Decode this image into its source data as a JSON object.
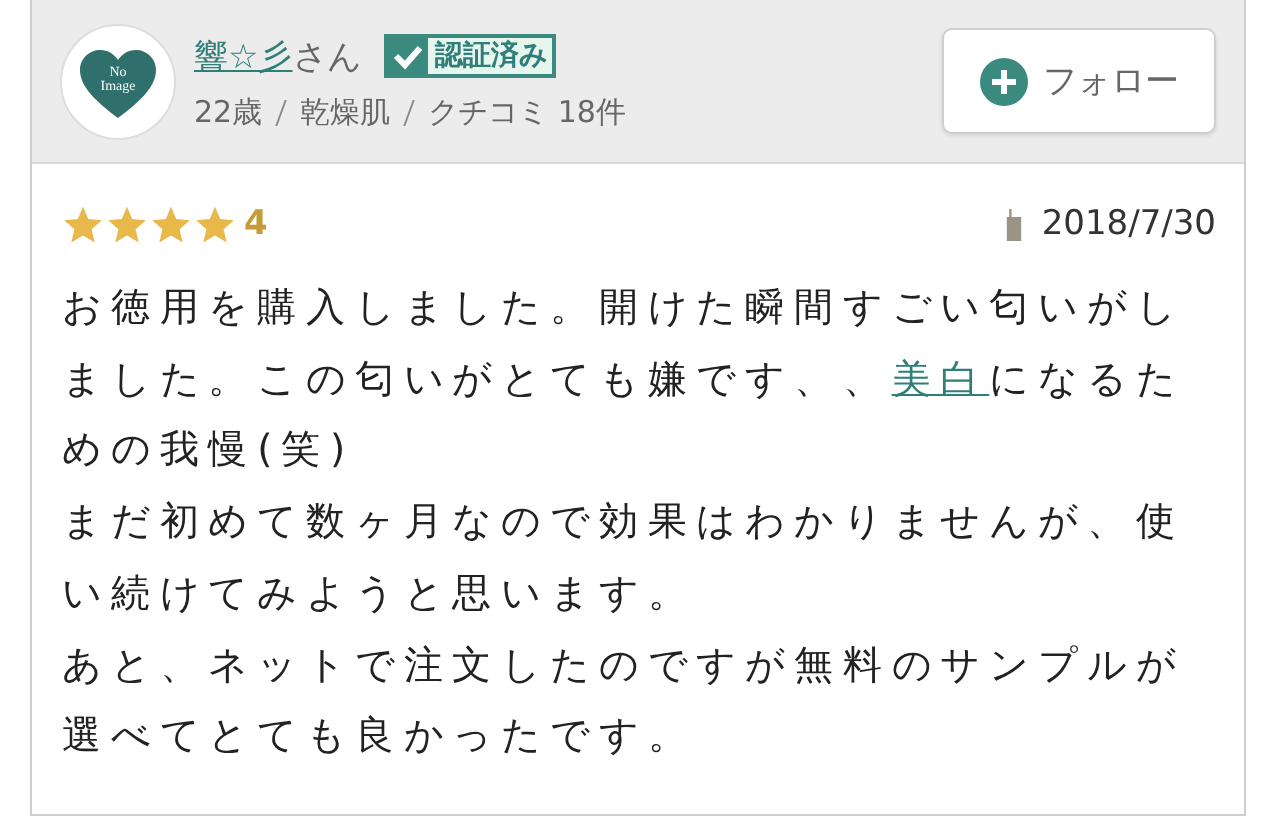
{
  "reviewer": {
    "avatar_text": "No Image",
    "name": "響☆彡",
    "honorific": "さん",
    "badge": "認証済み",
    "verified": true,
    "meta": [
      "22歳",
      "乾燥肌",
      "クチコミ 18件"
    ],
    "follow_button": "フォロー"
  },
  "review": {
    "stars": 4,
    "rating": "4",
    "date": "2018/7/30",
    "paragraphs": [
      [
        {
          "kind": "text",
          "text": "お徳用を購入しました。開けた瞬間すごい匂いがしました。この匂いがとても嫌です、、"
        },
        {
          "kind": "link",
          "text": "美白"
        },
        {
          "kind": "text",
          "text": "になるための我慢(笑)"
        }
      ],
      [
        {
          "kind": "text",
          "text": "まだ初めて数ヶ月なので効果はわかりませんが、使い続けてみようと思います。"
        }
      ],
      [
        {
          "kind": "text",
          "text": "あと、ネットで注文したのですが無料のサンプルが選べてとても良かったです。"
        }
      ]
    ]
  }
}
